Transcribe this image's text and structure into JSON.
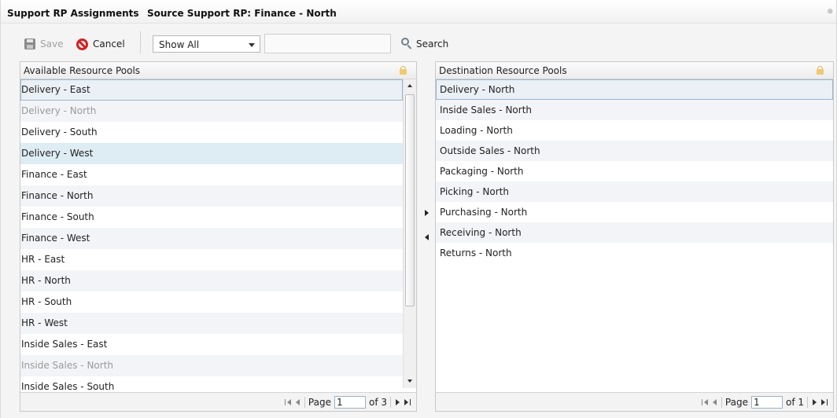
{
  "window": {
    "title": "Support RP Assignments",
    "subtitle": "Source Support RP: Finance - North"
  },
  "toolbar": {
    "save_label": "Save",
    "cancel_label": "Cancel",
    "filter_value": "Show All",
    "search_value": "",
    "search_label": "Search"
  },
  "left_panel": {
    "header": "Available Resource Pools",
    "items": [
      {
        "label": "Delivery - East",
        "state": "selected"
      },
      {
        "label": "Delivery - North",
        "state": "disabled"
      },
      {
        "label": "Delivery - South",
        "state": "normal"
      },
      {
        "label": "Delivery - West",
        "state": "hover"
      },
      {
        "label": "Finance - East",
        "state": "normal"
      },
      {
        "label": "Finance - North",
        "state": "normal"
      },
      {
        "label": "Finance - South",
        "state": "normal"
      },
      {
        "label": "Finance - West",
        "state": "normal"
      },
      {
        "label": "HR - East",
        "state": "normal"
      },
      {
        "label": "HR - North",
        "state": "normal"
      },
      {
        "label": "HR - South",
        "state": "normal"
      },
      {
        "label": "HR - West",
        "state": "normal"
      },
      {
        "label": "Inside Sales - East",
        "state": "normal"
      },
      {
        "label": "Inside Sales - North",
        "state": "disabled"
      },
      {
        "label": "Inside Sales - South",
        "state": "normal"
      }
    ],
    "pager": {
      "page_label": "Page",
      "page_value": "1",
      "of_label": "of 3"
    }
  },
  "right_panel": {
    "header": "Destination Resource Pools",
    "items": [
      {
        "label": "Delivery - North",
        "state": "selected"
      },
      {
        "label": "Inside Sales - North",
        "state": "normal"
      },
      {
        "label": "Loading - North",
        "state": "normal"
      },
      {
        "label": "Outside Sales - North",
        "state": "normal"
      },
      {
        "label": "Packaging - North",
        "state": "normal"
      },
      {
        "label": "Picking - North",
        "state": "normal"
      },
      {
        "label": "Purchasing - North",
        "state": "normal"
      },
      {
        "label": "Receiving - North",
        "state": "normal"
      },
      {
        "label": "Returns - North",
        "state": "normal"
      }
    ],
    "pager": {
      "page_label": "Page",
      "page_value": "1",
      "of_label": "of 1"
    }
  },
  "colors": {
    "selected_row_border": "#9ab6cc",
    "hover_row": "#deecf3",
    "alt_row": "#f2f4f7",
    "cancel_red": "#d42020",
    "disabled_text": "#9a9a9a"
  },
  "icons": [
    "save-icon",
    "cancel-icon",
    "chevron-down-icon",
    "search-icon",
    "lock-icon",
    "first-page-icon",
    "prev-page-icon",
    "next-page-icon",
    "last-page-icon",
    "move-right-icon",
    "move-left-icon"
  ]
}
